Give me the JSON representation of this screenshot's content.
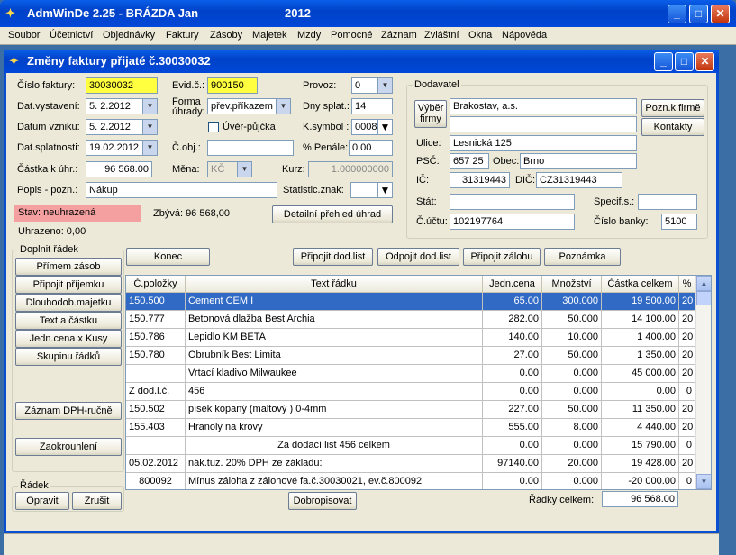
{
  "app": {
    "title": "AdmWinDe 2.25 - BRÁZDA Jan",
    "year": "2012"
  },
  "menu": [
    "Soubor",
    "Účetnictví",
    "Objednávky",
    "Faktury",
    "Zásoby",
    "Majetek",
    "Mzdy",
    "Pomocné",
    "Záznam",
    "Zvláštní",
    "Okna",
    "Nápověda"
  ],
  "window": {
    "title": "Změny faktury přijaté č.30030032"
  },
  "form": {
    "cislo_faktury_label": "Číslo faktury:",
    "cislo_faktury": "30030032",
    "evid_label": "Evid.č.:",
    "evid": "900150",
    "provoz_label": "Provoz:",
    "provoz": "0",
    "dat_vystaveni_label": "Dat.vystavení:",
    "dat_vystaveni": "5. 2.2012",
    "forma_label": "Forma úhrady:",
    "forma": "přev.příkazem",
    "dny_splat_label": "Dny splat.:",
    "dny_splat": "14",
    "datum_vzniku_label": "Datum vzniku:",
    "datum_vzniku": "5. 2.2012",
    "uver_label": "Úvěr-půjčka",
    "ksymbol_label": "K.symbol :",
    "ksymbol": "0008",
    "dat_splatnosti_label": "Dat.splatnosti:",
    "dat_splatnosti": "19.02.2012",
    "cobj_label": "Č.obj.:",
    "cobj": "",
    "penale_label": "% Penále:",
    "penale": "0.00",
    "castka_label": "Částka k úhr.:",
    "castka": "96 568.00",
    "mena_label": "Měna:",
    "mena": "KČ",
    "kurz_label": "Kurz:",
    "kurz": "1.000000000",
    "popis_label": "Popis - pozn.:",
    "popis": "Nákup",
    "statistic_label": "Statistic.znak:",
    "statistic": ""
  },
  "status": {
    "stav": "Stav: neuhrazená",
    "zbyva": "Zbývá: 96 568,00",
    "prehled_button": "Detailní přehled úhrad",
    "uhrazeno": "Uhrazeno: 0,00"
  },
  "dodavatel": {
    "group_label": "Dodavatel",
    "vyber_button": "Výběr firmy",
    "name": "Brakostav, a.s.",
    "name2": "",
    "pozn_button": "Pozn.k firmě",
    "kontakty_button": "Kontakty",
    "ulice_label": "Ulice:",
    "ulice": "Lesnická 125",
    "psc_label": "PSČ:",
    "psc": "657 25",
    "obec_label": "Obec:",
    "obec": "Brno",
    "ic_label": "IČ:",
    "ic": "31319443",
    "dic_label": "DIČ:",
    "dic": "CZ31319443",
    "stat_label": "Stát:",
    "stat": "",
    "specif_label": "Specif.s.:",
    "specif": "",
    "ucet_label": "Č.účtu:",
    "ucet": "102197764",
    "banka_label": "Číslo banky:",
    "banka": "5100"
  },
  "doplnit": {
    "label": "Doplnit řádek",
    "buttons": [
      "Přímem zásob",
      "Připojit příjemku",
      "Dlouhodob.majetku",
      "Text a částku",
      "Jedn.cena x Kusy",
      "Skupinu řádků",
      "Záznam DPH-ručně",
      "Zaokrouhlení"
    ]
  },
  "radek": {
    "label": "Řádek",
    "opravit": "Opravit",
    "zrusit": "Zrušit"
  },
  "toolbar": {
    "konec": "Konec",
    "pripojit_dl": "Připojit dod.list",
    "odpojit_dl": "Odpojit dod.list",
    "pripojit_zal": "Připojit zálohu",
    "poznamka": "Poznámka"
  },
  "table": {
    "headers": [
      "Č.položky",
      "Text řádku",
      "Jedn.cena",
      "Množství",
      "Částka celkem",
      "%"
    ],
    "rows": [
      [
        "150.500",
        "Cement CEM I",
        "65.00",
        "300.000",
        "19 500.00",
        "20"
      ],
      [
        "150.777",
        "Betonová dlažba Best Archia",
        "282.00",
        "50.000",
        "14 100.00",
        "20"
      ],
      [
        "150.786",
        "Lepidlo KM BETA",
        "140.00",
        "10.000",
        "1 400.00",
        "20"
      ],
      [
        "150.780",
        "Obrubník Best Limita",
        "27.00",
        "50.000",
        "1 350.00",
        "20"
      ],
      [
        "",
        "Vrtací kladivo Milwaukee",
        "0.00",
        "0.000",
        "45 000.00",
        "20"
      ],
      [
        "Z dod.l.č.",
        "456",
        "0.00",
        "0.000",
        "0.00",
        "0"
      ],
      [
        "150.502",
        "písek kopaný (maltový ) 0-4mm",
        "227.00",
        "50.000",
        "11 350.00",
        "20"
      ],
      [
        "155.403",
        "Hranoly na krovy",
        "555.00",
        "8.000",
        "4 440.00",
        "20"
      ],
      [
        "",
        "Za dodací list 456 celkem",
        "0.00",
        "0.000",
        "15 790.00",
        "0"
      ],
      [
        "05.02.2012",
        "nák.tuz. 20% DPH ze základu:",
        "97140.00",
        "20.000",
        "19 428.00",
        "20"
      ],
      [
        "800092",
        "Mínus záloha z zálohové fa.č.30030021, ev.č.800092",
        "0.00",
        "0.000",
        "-20 000.00",
        "0"
      ]
    ]
  },
  "footer": {
    "dobropisovat": "Dobropisovat",
    "radky_celkem_label": "Řádky celkem:",
    "radky_celkem": "96 568.00"
  }
}
